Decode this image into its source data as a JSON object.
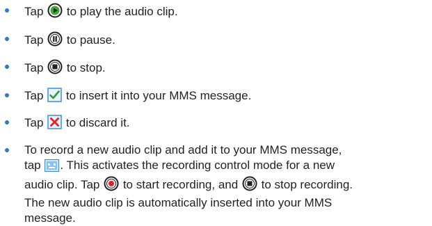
{
  "items": [
    {
      "before": "Tap ",
      "icon": "play-icon",
      "after": " to play the audio clip."
    },
    {
      "before": "Tap ",
      "icon": "pause-icon",
      "after": " to pause."
    },
    {
      "before": "Tap ",
      "icon": "stop-icon",
      "after": " to stop."
    },
    {
      "before": "Tap ",
      "icon": "checkmark-icon",
      "after": " to insert it into your MMS message."
    },
    {
      "before": "Tap ",
      "icon": "discard-x-icon",
      "after": " to discard it."
    }
  ],
  "last_item": {
    "line1": "To record a new audio clip and add it to your MMS message,",
    "line2_before": "tap ",
    "line2_icon": "new-audio-clip-icon",
    "line2_after": ". This activates the recording control mode for a new",
    "line3_before": "audio clip. Tap ",
    "line3_icon1": "record-icon",
    "line3_middle": " to start recording, and ",
    "line3_icon2": "stop-icon",
    "line3_after": " to stop recording.",
    "line4": "The new audio clip is automatically inserted into your MMS",
    "line5": "message."
  },
  "colors": {
    "bullet": "#2a7ac4",
    "play_green": "#3aa935",
    "record_red": "#e31e24",
    "check_green": "#2e9e3a",
    "discard_red": "#e3262c",
    "icon_frame_blue": "#3b8fd8"
  }
}
